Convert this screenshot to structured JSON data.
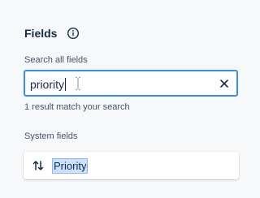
{
  "header": {
    "title": "Fields",
    "info_icon": "info-icon"
  },
  "search": {
    "label": "Search all fields",
    "value": "priority",
    "clear_icon": "close-icon"
  },
  "helper_text": "1 result match your search",
  "system_fields": {
    "label": "System fields",
    "items": [
      {
        "name": "Priority",
        "icon": "sort-arrows-icon"
      }
    ]
  },
  "colors": {
    "accent_border": "#388bff",
    "highlight": "#cce0ff",
    "text": "#172b4d",
    "muted": "#44546f"
  }
}
